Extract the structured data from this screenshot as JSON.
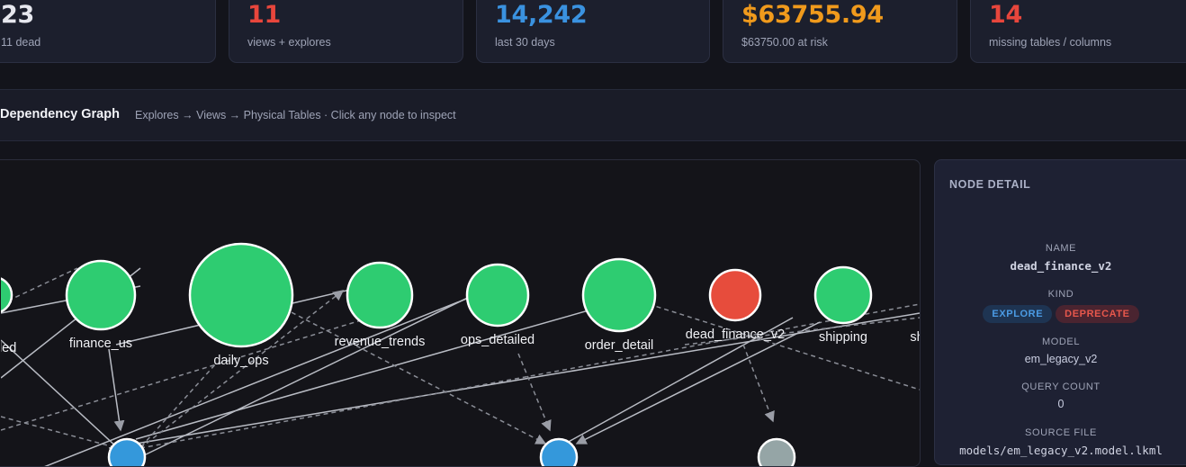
{
  "stats": [
    {
      "value": "23",
      "sub": "11 dead",
      "color": "#e6e7ee"
    },
    {
      "value": "11",
      "sub": "views + explores",
      "color": "#e8463c"
    },
    {
      "value": "14,242",
      "sub": "last 30 days",
      "color": "#3a92e0"
    },
    {
      "value": "$63755.94",
      "sub": "$63750.00 at risk",
      "color": "#f09a1c"
    },
    {
      "value": "14",
      "sub": "missing tables / columns",
      "color": "#e8463c"
    }
  ],
  "section": {
    "title": "Dependency Graph",
    "hint": "Explores → Views → Physical Tables  ·  Click any node to inspect"
  },
  "graph": {
    "colors": {
      "explore": "#2ecc71",
      "dead": "#e74c3c",
      "view": "#3498db",
      "table": "#95a5a6",
      "edge": "#b9bcc4"
    },
    "nodes": [
      {
        "id": "ops_detailed_partial",
        "label": "iled",
        "kind": "explore"
      },
      {
        "id": "finance_us",
        "label": "finance_us",
        "kind": "explore"
      },
      {
        "id": "daily_ops",
        "label": "daily_ops",
        "kind": "explore"
      },
      {
        "id": "revenue_trends",
        "label": "revenue_trends",
        "kind": "explore"
      },
      {
        "id": "ops_detailed",
        "label": "ops_detailed",
        "kind": "explore"
      },
      {
        "id": "order_detail",
        "label": "order_detail",
        "kind": "explore"
      },
      {
        "id": "dead_finance_v2",
        "label": "dead_finance_v2",
        "kind": "dead"
      },
      {
        "id": "shipping",
        "label": "shipping",
        "kind": "explore"
      },
      {
        "id": "sh_partial",
        "label": "sh",
        "kind": "explore"
      },
      {
        "id": "view_a",
        "label": "",
        "kind": "view"
      },
      {
        "id": "view_b",
        "label": "",
        "kind": "view"
      },
      {
        "id": "table_a",
        "label": "",
        "kind": "table"
      }
    ]
  },
  "panel": {
    "title": "NODE DETAIL",
    "name_label": "NAME",
    "name": "dead_finance_v2",
    "kind_label": "KIND",
    "kinds": [
      "EXPLORE",
      "DEPRECATE"
    ],
    "model_label": "MODEL",
    "model": "em_legacy_v2",
    "query_label": "QUERY COUNT",
    "query": "0",
    "source_label": "SOURCE FILE",
    "source": "models/em_legacy_v2.model.lkml"
  }
}
